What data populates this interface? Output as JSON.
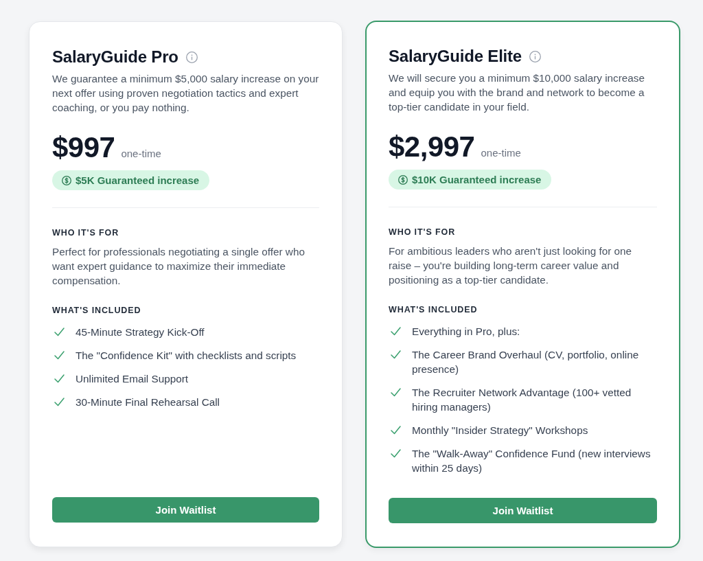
{
  "plans": [
    {
      "name": "SalaryGuide Pro",
      "selected": false,
      "description": "We guarantee a minimum $5,000 salary increase on your next offer using proven negotiation tactics and expert coaching, or you pay nothing.",
      "price": "$997",
      "price_note": "one-time",
      "badge": "$5K Guaranteed increase",
      "audience_heading": "WHO IT'S FOR",
      "audience": "Perfect for professionals negotiating a single offer who want expert guidance to maximize their immediate compensation.",
      "features_heading": "WHAT'S INCLUDED",
      "features": [
        "45-Minute Strategy Kick-Off",
        "The \"Confidence Kit\" with checklists and scripts",
        "Unlimited Email Support",
        "30-Minute Final Rehearsal Call"
      ],
      "button": "Join Waitlist"
    },
    {
      "name": "SalaryGuide Elite",
      "selected": true,
      "description": "We will secure you a minimum $10,000 salary increase and equip you with the brand and network to become a top-tier candidate in your field.",
      "price": "$2,997",
      "price_note": "one-time",
      "badge": "$10K Guaranteed increase",
      "audience_heading": "WHO IT'S FOR",
      "audience": "For ambitious leaders who aren't just looking for one raise – you're building long-term career value and positioning as a top-tier candidate.",
      "features_heading": "WHAT'S INCLUDED",
      "features": [
        "Everything in Pro, plus:",
        "The Career Brand Overhaul (CV, portfolio, online presence)",
        "The Recruiter Network Advantage (100+ vetted hiring managers)",
        "Monthly \"Insider Strategy\" Workshops",
        "The \"Walk-Away\" Confidence Fund (new interviews within 25 days)"
      ],
      "button": "Join Waitlist"
    }
  ]
}
